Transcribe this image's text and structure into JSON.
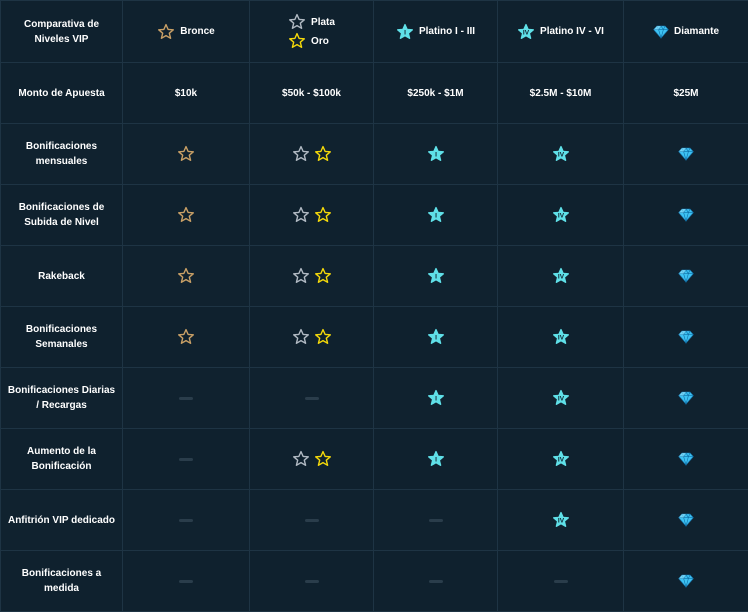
{
  "colors": {
    "background": "#0f212e",
    "border": "#1e3444",
    "bronze": "#c9a066",
    "silver": "#b1bac3",
    "gold": "#f5d90a",
    "platinum": "#5fe0e8",
    "diamond": "#3ec2f2",
    "dash": "#2a3d4b"
  },
  "header": {
    "corner": "Comparativa de Niveles VIP",
    "tiers": {
      "bronce": {
        "label": "Bronce",
        "icon": "bronze-star-icon"
      },
      "plata": {
        "label": "Plata",
        "icon": "silver-star-icon"
      },
      "oro": {
        "label": "Oro",
        "icon": "gold-star-icon"
      },
      "platino1": {
        "label": "Platino I - III",
        "icon": "platinum-1-star-icon"
      },
      "platino4": {
        "label": "Platino IV - VI",
        "icon": "platinum-4-star-icon"
      },
      "diamante": {
        "label": "Diamante",
        "icon": "diamond-icon"
      }
    }
  },
  "rows": [
    {
      "label": "Monto de Apuesta",
      "values": [
        "$10k",
        "$50k - $100k",
        "$250k - $1M",
        "$2.5M - $10M",
        "$25M"
      ]
    },
    {
      "label": "Bonificaciones mensuales",
      "cells": [
        [
          "bronze"
        ],
        [
          "silver",
          "gold"
        ],
        [
          "platinum1"
        ],
        [
          "platinum4"
        ],
        [
          "diamond"
        ]
      ]
    },
    {
      "label": "Bonificaciones de Subida de Nivel",
      "cells": [
        [
          "bronze"
        ],
        [
          "silver",
          "gold"
        ],
        [
          "platinum1"
        ],
        [
          "platinum4"
        ],
        [
          "diamond"
        ]
      ]
    },
    {
      "label": "Rakeback",
      "cells": [
        [
          "bronze"
        ],
        [
          "silver",
          "gold"
        ],
        [
          "platinum1"
        ],
        [
          "platinum4"
        ],
        [
          "diamond"
        ]
      ]
    },
    {
      "label": "Bonificaciones Semanales",
      "cells": [
        [
          "bronze"
        ],
        [
          "silver",
          "gold"
        ],
        [
          "platinum1"
        ],
        [
          "platinum4"
        ],
        [
          "diamond"
        ]
      ]
    },
    {
      "label": "Bonificaciones Diarias / Recargas",
      "cells": [
        [
          "dash"
        ],
        [
          "dash"
        ],
        [
          "platinum1"
        ],
        [
          "platinum4"
        ],
        [
          "diamond"
        ]
      ]
    },
    {
      "label": "Aumento de la Bonificación",
      "cells": [
        [
          "dash"
        ],
        [
          "silver",
          "gold"
        ],
        [
          "platinum1"
        ],
        [
          "platinum4"
        ],
        [
          "diamond"
        ]
      ]
    },
    {
      "label": "Anfitrión VIP dedicado",
      "cells": [
        [
          "dash"
        ],
        [
          "dash"
        ],
        [
          "dash"
        ],
        [
          "platinum4"
        ],
        [
          "diamond"
        ]
      ]
    },
    {
      "label": "Bonificaciones a medida",
      "cells": [
        [
          "dash"
        ],
        [
          "dash"
        ],
        [
          "dash"
        ],
        [
          "dash"
        ],
        [
          "diamond"
        ]
      ]
    }
  ]
}
